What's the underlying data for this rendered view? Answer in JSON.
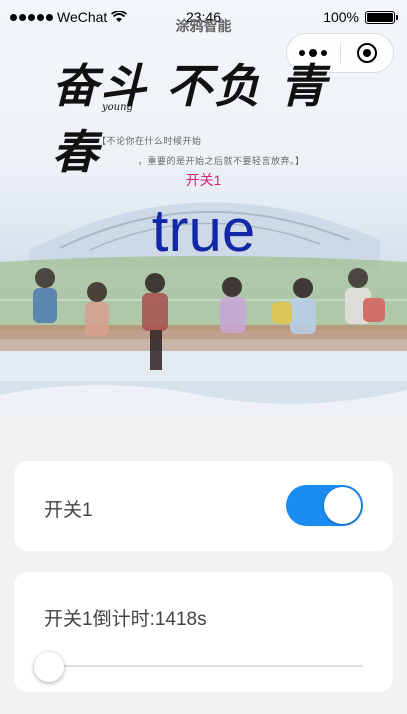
{
  "status_bar": {
    "carrier": "WeChat",
    "time": "23:46",
    "battery_text": "100%",
    "battery_level": 1.0
  },
  "nav": {
    "title": "涂鸦智能"
  },
  "banner": {
    "calligraphy": "奋斗 不负 青春",
    "calligraphy_sub": "young",
    "quote_line1": "【不论你在什么时候开始",
    "quote_line2": "，重要的是开始之后就不要轻言放弃。】",
    "switch_name": "开关1",
    "switch_state": "true"
  },
  "switch_card": {
    "label": "开关1",
    "on": true,
    "accent": "#1a8cf0"
  },
  "timer_card": {
    "label": "开关1倒计时:1418s",
    "slider_value": 0
  },
  "colors": {
    "switch_label_color": "#d4237a",
    "state_text_color": "#1228a8",
    "page_bg": "#f2f2f2"
  }
}
